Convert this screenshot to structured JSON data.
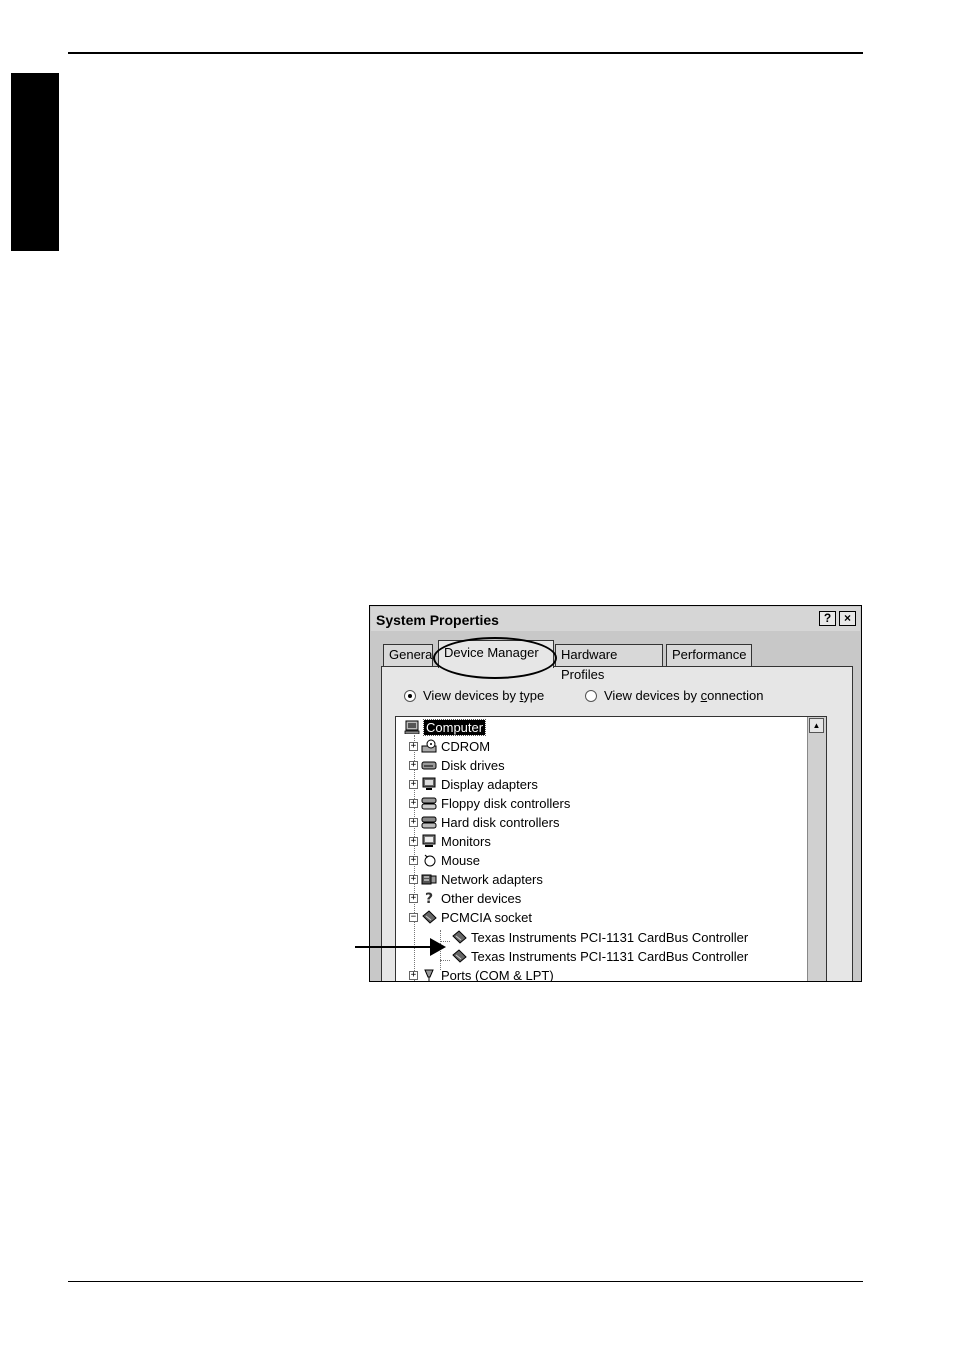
{
  "window": {
    "title": "System Properties",
    "help_glyph": "?",
    "close_glyph": "×"
  },
  "tabs": [
    {
      "label": "General",
      "display": "Genera"
    },
    {
      "label": "Device Manager"
    },
    {
      "label": "Hardware Profiles",
      "display": "Hardware Profiles"
    },
    {
      "label": "Performance"
    }
  ],
  "view_options": {
    "by_type": {
      "pre": "View devices by ",
      "key": "t",
      "post": "ype",
      "selected": true
    },
    "by_connection": {
      "pre": "View devices by ",
      "key": "c",
      "post": "onnection",
      "selected": false
    }
  },
  "device_tree": {
    "root": "Computer",
    "items": [
      {
        "label": "CDROM",
        "icon": "cdrom-icon",
        "expander": "+"
      },
      {
        "label": "Disk drives",
        "icon": "disk-drive-icon",
        "expander": "+"
      },
      {
        "label": "Display adapters",
        "icon": "display-adapter-icon",
        "expander": "+"
      },
      {
        "label": "Floppy disk controllers",
        "icon": "floppy-controller-icon",
        "expander": "+"
      },
      {
        "label": "Hard disk controllers",
        "icon": "hard-disk-controller-icon",
        "expander": "+"
      },
      {
        "label": "Monitors",
        "icon": "monitor-icon",
        "expander": "+"
      },
      {
        "label": "Mouse",
        "icon": "mouse-icon",
        "expander": "+"
      },
      {
        "label": "Network adapters",
        "icon": "network-adapter-icon",
        "expander": "+"
      },
      {
        "label": "Other devices",
        "icon": "question-icon",
        "expander": "+"
      },
      {
        "label": "PCMCIA socket",
        "icon": "pcmcia-icon",
        "expander": "−"
      },
      {
        "label": "Texas Instruments PCI-1131 CardBus Controller",
        "icon": "pcmcia-card-icon",
        "child": true
      },
      {
        "label": "Texas Instruments PCI-1131 CardBus Controller",
        "icon": "pcmcia-card-icon",
        "child": true
      },
      {
        "label": "Ports (COM & LPT)",
        "icon": "port-icon",
        "expander": "+"
      }
    ]
  }
}
